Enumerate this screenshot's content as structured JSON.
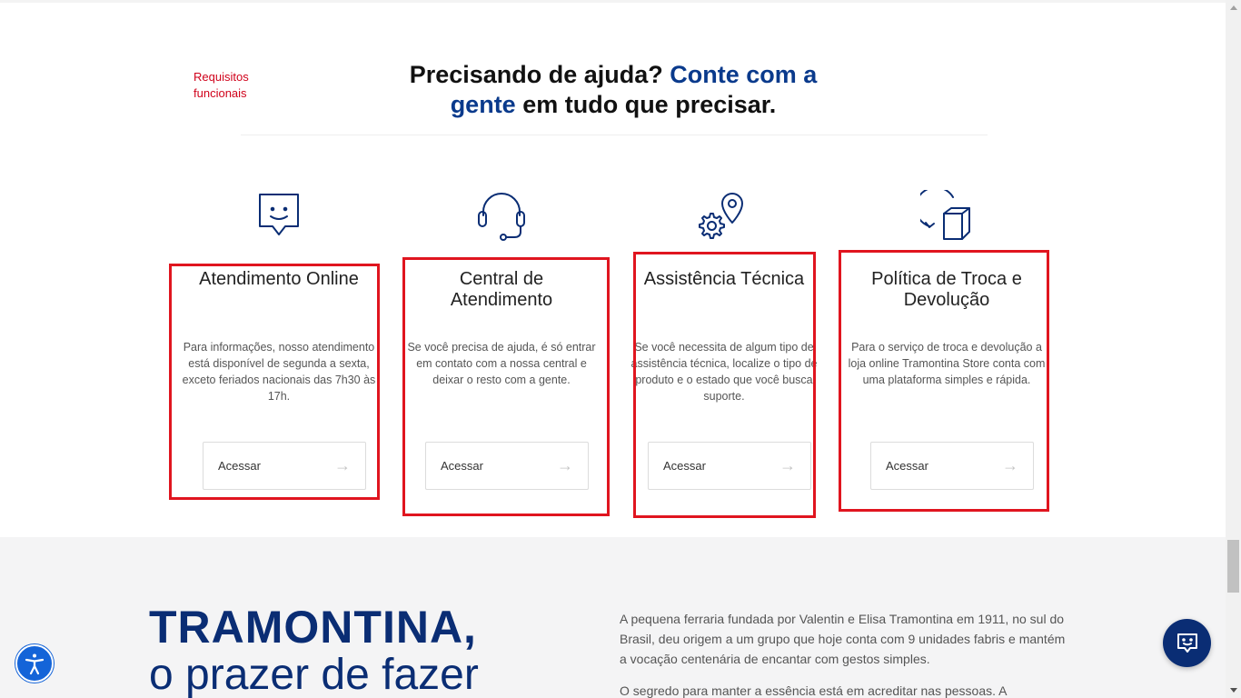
{
  "annotation": {
    "label": "Requisitos funcionais",
    "color": "#d0021b"
  },
  "section": {
    "title_part1": "Precisando de ajuda? ",
    "title_accent": "Conte com a gente",
    "title_part2": " em tudo que precisar.",
    "accent_color": "#0a3a8c"
  },
  "cards": [
    {
      "icon": "chat-bubble-smile-icon",
      "title": "Atendimento Online",
      "description": "Para informações, nosso atendimento está disponível de segunda a sexta, exceto feriados nacionais das 7h30 às 17h.",
      "button_label": "Acessar"
    },
    {
      "icon": "headset-icon",
      "title": "Central de Atendimento",
      "description": "Se você precisa de ajuda, é só entrar em contato com a nossa central e deixar o resto com a gente.",
      "button_label": "Acessar"
    },
    {
      "icon": "gear-location-pin-icon",
      "title": "Assistência Técnica",
      "description": "Se você necessita de algum tipo de assistência técnica, localize o tipo de produto e o estado que você busca suporte.",
      "button_label": "Acessar"
    },
    {
      "icon": "box-return-icon",
      "title": "Política de Troca e Devolução",
      "description": "Para o serviço de troca e devolução a loja online Tramontina Store conta com uma plataforma simples e rápida.",
      "button_label": "Acessar"
    }
  ],
  "highlight_color": "#e0151f",
  "brand": {
    "title": "TRAMONTINA,",
    "subtitle": "o prazer de fazer",
    "color": "#0a2d74"
  },
  "about": {
    "paragraph1": "A pequena ferraria fundada por Valentin e Elisa Tramontina em 1911, no sul do Brasil, deu origem a um grupo que hoje conta com 9 unidades fabris e mantém a vocação centenária de encantar com gestos simples.",
    "paragraph2": "O segredo para manter a essência está em acreditar nas pessoas. A"
  },
  "floating": {
    "accessibility_icon": "accessibility-icon",
    "chat_icon": "chat-support-icon"
  }
}
